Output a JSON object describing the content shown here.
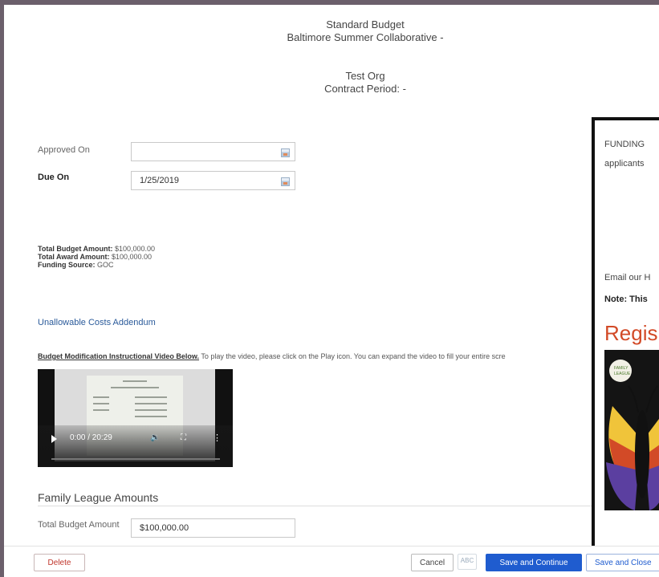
{
  "header": {
    "line1": "Standard Budget",
    "line2": "Baltimore Summer Collaborative -",
    "line3": "Test Org",
    "line4": "Contract Period:  -"
  },
  "form": {
    "approved_label": "Approved On",
    "approved_value": "",
    "due_label": "Due On",
    "due_value": "1/25/2019"
  },
  "summary": {
    "budget_label": "Total Budget Amount:",
    "budget_value": "$100,000.00",
    "award_label": "Total Award Amount:",
    "award_value": "$100,000.00",
    "funding_label": "Funding Source:",
    "funding_value": "GOC"
  },
  "link": "Unallowable Costs Addendum",
  "instructions": {
    "title": "Budget Modification Instructional Video Below.",
    "text": " To play the video, please click on the Play icon. You can expand the video to fill your entire scre"
  },
  "video": {
    "time": "0:00 / 20:29",
    "volume_icon": "🔉",
    "fullscreen_icon": "⛶",
    "more_icon": "⋮"
  },
  "section": {
    "title": "Family League Amounts",
    "total_label": "Total Budget Amount",
    "total_value": "$100,000.00"
  },
  "side_panel": {
    "line1": "FUNDING",
    "line2": "applicants",
    "line3": "Email our H",
    "line4": "Note: This",
    "heading": "Regis",
    "poster_text1": "FAMILY",
    "poster_text2": "LEAGUE"
  },
  "footer": {
    "delete": "Delete",
    "cancel": "Cancel",
    "spell": "ABC",
    "save_continue": "Save and Continue",
    "save_close": "Save and Close"
  },
  "colors": {
    "primary": "#1f5ccf",
    "delete": "#c0362c",
    "register": "#d24a27",
    "link": "#2a5a9a"
  }
}
